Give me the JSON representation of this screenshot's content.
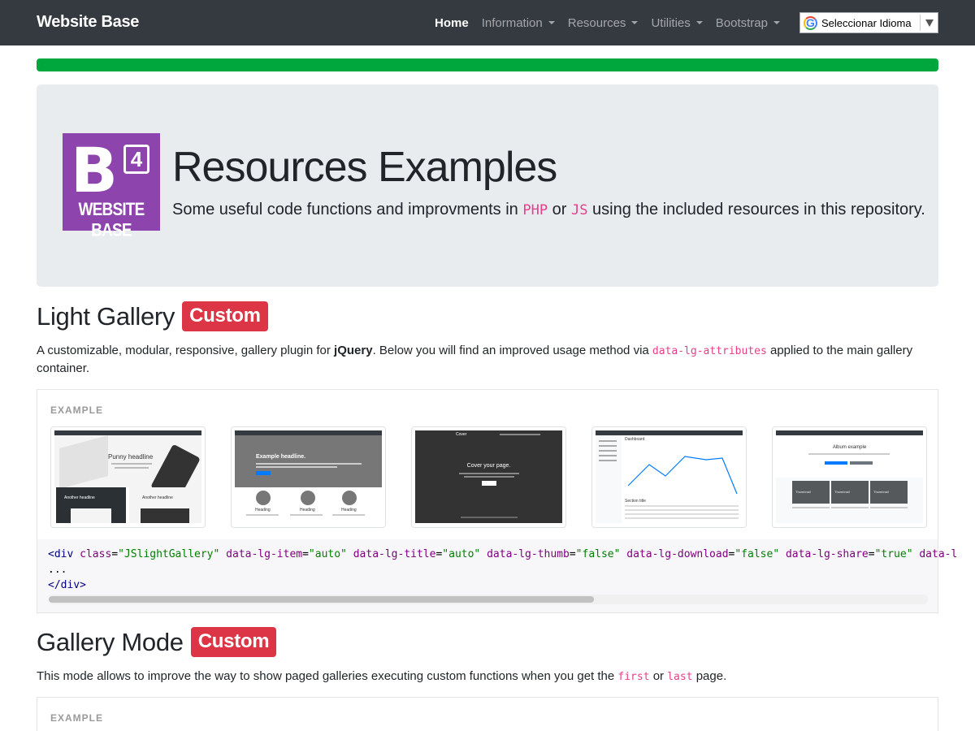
{
  "navbar": {
    "brand": "Website Base",
    "items": [
      {
        "label": "Home",
        "active": true,
        "dropdown": false
      },
      {
        "label": "Information",
        "active": false,
        "dropdown": true
      },
      {
        "label": "Resources",
        "active": false,
        "dropdown": true
      },
      {
        "label": "Utilities",
        "active": false,
        "dropdown": true
      },
      {
        "label": "Bootstrap",
        "active": false,
        "dropdown": true
      }
    ],
    "translate_label": "Seleccionar Idioma",
    "translate_logo": "G"
  },
  "progress": {
    "value_percent": 100,
    "color": "#00a73c"
  },
  "jumbotron": {
    "logo_letter": "B",
    "logo_version": "4",
    "logo_text": "WEBSITE BASE",
    "logo_color": "#8e44ad",
    "title": "Resources Examples",
    "lead_pre": "Some useful code functions and improvments in ",
    "lead_code1": "PHP",
    "lead_mid": " or ",
    "lead_code2": "JS",
    "lead_post": " using the included resources in this repository."
  },
  "light_gallery": {
    "title": "Light Gallery",
    "badge": "Custom",
    "desc_pre": "A customizable, modular, responsive, gallery plugin for ",
    "desc_bold": "jQuery",
    "desc_mid": ". Below you will find an improved usage method via ",
    "desc_code": "data-lg-attributes",
    "desc_post": " applied to the main gallery container.",
    "example_label": "EXAMPLE",
    "thumbnails": [
      {
        "name": "carousel-example",
        "headline": "Punny headline",
        "sub1": "Another headline",
        "sub2": "Another headline"
      },
      {
        "name": "jumbotron-example",
        "headline": "Example headline.",
        "sub1": "Heading",
        "sub2": "Heading",
        "sub3": "Heading"
      },
      {
        "name": "cover-example",
        "headline": "Cover your page.",
        "brand": "Cover"
      },
      {
        "name": "dashboard-example",
        "headline": "Dashboard",
        "sub1": "Section title"
      },
      {
        "name": "album-example",
        "headline": "Album example",
        "sub1": "Thumbnail",
        "sub2": "Thumbnail",
        "sub3": "Thumbnail"
      }
    ],
    "code": {
      "line1_tag_open": "<div ",
      "line1_attrs": [
        {
          "name": "class",
          "value": "\"JSlightGallery\""
        },
        {
          "name": "data-lg-item",
          "value": "\"auto\""
        },
        {
          "name": "data-lg-title",
          "value": "\"auto\""
        },
        {
          "name": "data-lg-thumb",
          "value": "\"false\""
        },
        {
          "name": "data-lg-download",
          "value": "\"false\""
        },
        {
          "name": "data-lg-share",
          "value": "\"true\""
        }
      ],
      "line1_tail": " data-l",
      "line2": "...",
      "line3": "</div>"
    },
    "scroll_fraction": 0.62
  },
  "gallery_mode": {
    "title": "Gallery Mode",
    "badge": "Custom",
    "desc_pre": "This mode allows to improve the way to show paged galleries executing custom functions when you get the ",
    "desc_code1": "first",
    "desc_mid": " or ",
    "desc_code2": "last",
    "desc_post": " page.",
    "example_label": "EXAMPLE"
  },
  "colors": {
    "navbar_bg": "#343a40",
    "badge_red": "#dc3545",
    "code_pink": "#e83e8c",
    "jumbotron_bg": "#e9ecef"
  }
}
